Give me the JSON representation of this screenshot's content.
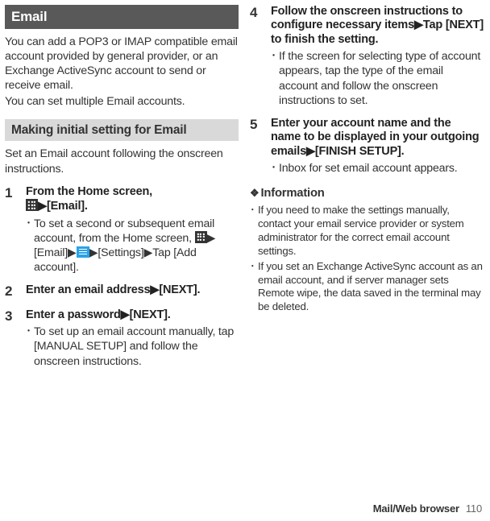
{
  "left": {
    "header": "Email",
    "intro1": "You can add a POP3 or IMAP compatible email account provided by general provider, or an Exchange ActiveSync account to send or receive email.",
    "intro2": "You can set multiple Email accounts.",
    "subheader": "Making initial setting for Email",
    "subintro": "Set an Email account following the onscreen instructions.",
    "steps": [
      {
        "num": "1",
        "title_pre": "From the Home screen, ",
        "title_post": "[Email].",
        "bullets": [
          {
            "pre": "To set a second or subsequent email account, from the Home screen, ",
            "mid1": "[Email]",
            "mid2": "[Settings]",
            "post": "Tap [Add account]."
          }
        ]
      },
      {
        "num": "2",
        "title_pre": "Enter an email address",
        "title_post": "[NEXT].",
        "bullets": []
      },
      {
        "num": "3",
        "title_pre": "Enter a password",
        "title_post": "[NEXT].",
        "bullets": [
          {
            "plain": "To set up an email account manually, tap [MANUAL SETUP] and follow the onscreen instructions."
          }
        ]
      }
    ]
  },
  "right": {
    "steps": [
      {
        "num": "4",
        "title_pre": "Follow the onscreen instructions to configure necessary items",
        "title_post": "Tap [NEXT] to finish the setting.",
        "bullets": [
          {
            "plain": "If the screen for selecting type of account appears, tap the type of the email account and follow the onscreen instructions to set."
          }
        ]
      },
      {
        "num": "5",
        "title_pre": "Enter your account name and the name to be displayed in your outgoing emails",
        "title_post": "[FINISH SETUP].",
        "bullets": [
          {
            "plain": "Inbox for set email account appears."
          }
        ]
      }
    ],
    "info_header": "Information",
    "info_lead": "❖",
    "info": [
      "If you need to make the settings manually, contact your email service provider or system administrator for the correct email account settings.",
      "If you set an Exchange ActiveSync account as an email account, and if server manager sets Remote wipe, the data saved in the terminal may be deleted."
    ]
  },
  "tri": "▶",
  "dot": "･",
  "footer": {
    "label": "Mail/Web browser",
    "page": "110"
  }
}
